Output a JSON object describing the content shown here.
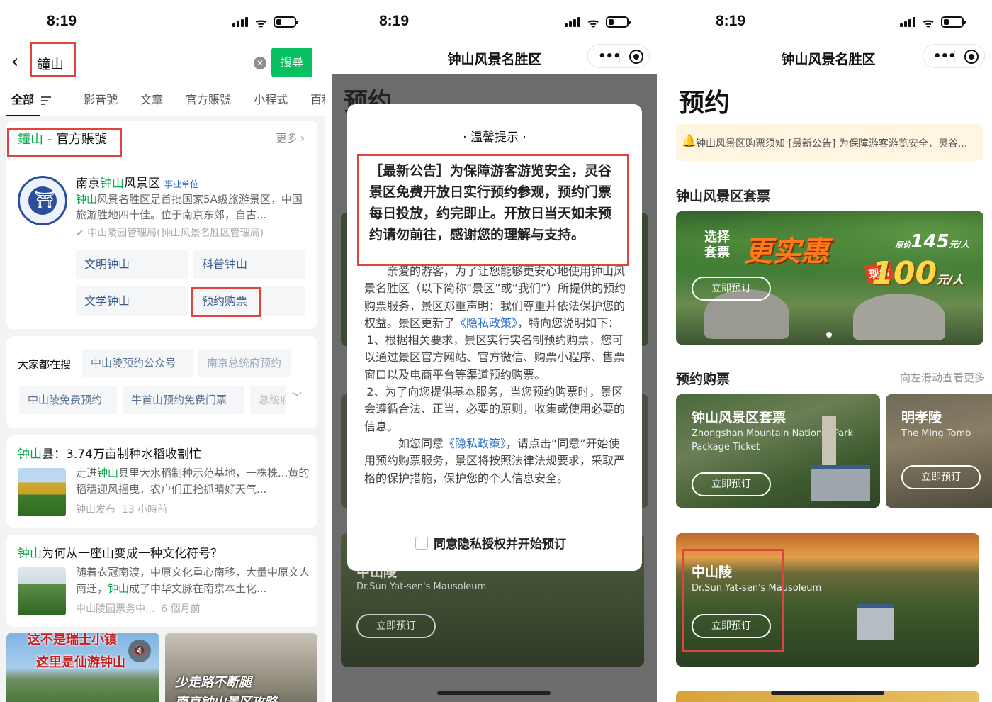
{
  "status": {
    "time": "8:19"
  },
  "search_panel": {
    "query": "鐘山",
    "search_button": "搜尋",
    "tabs": [
      "全部",
      "影音號",
      "文章",
      "官方賬號",
      "小程式",
      "百科"
    ],
    "official": {
      "heading_keyword": "鐘山",
      "heading_suffix": " - 官方賬號",
      "more": "更多",
      "name_prefix": "南京",
      "name_keyword": "钟山",
      "name_suffix": "风景区",
      "tag": "事业单位",
      "desc_keyword": "钟山",
      "desc_rest": "风景名胜区是首批国家5A级旅游景区，中国旅游胜地四十佳。位于南京东郊，自古...",
      "verified": "中山陵园管理局(钟山风景名胜区管理局)",
      "links": [
        "文明钟山",
        "科普钟山",
        "文学钟山",
        "预约购票"
      ]
    },
    "trending": {
      "label": "大家都在搜",
      "items": [
        "中山陵预约公众号",
        "南京总统府预约",
        "中山陵免费预约",
        "牛首山预约免费门票",
        "总统府"
      ]
    },
    "articles": [
      {
        "title_keyword": "钟山",
        "title_rest": "县：3.74万亩制种水稻收割忙",
        "desc_a": "走进",
        "desc_keyword": "钟山",
        "desc_b": "县里大水稻制种示范基地，一株株...黄的稻穗迎风摇曳，农户们正抢抓晴好天气...",
        "source": "钟山发布",
        "time": "13 小時前"
      },
      {
        "title_keyword": "钟山",
        "title_rest": "为何从一座山变成一种文化符号？",
        "desc_a": "随着衣冠南渡，中原文化重心南移，大量中原文人南迁，",
        "desc_keyword": "钟山",
        "desc_b": "成了中华文脉在南京本土化...",
        "source": "中山陵园票务中...",
        "time": "6 個月前"
      }
    ],
    "videos": [
      {
        "line1": "这不是瑞士小镇",
        "line2": "这里是仙游钟山"
      },
      {
        "line1": "少走路不断腿",
        "line2": "南京钟山景区攻略"
      }
    ]
  },
  "modal_panel": {
    "header_title": "钟山风景名胜区",
    "bg_title": "预约",
    "bg_card_name": "中山陵",
    "bg_card_en": "Dr.Sun Yat-sen's Mausoleum",
    "bg_card_button": "立即预订",
    "title": "· 温馨提示 ·",
    "notice": "［最新公告］为保障游客游览安全，灵谷景区免费开放日实行预约参观，预约门票每日投放，约完即止。开放日当天如未预约请勿前往，感谢您的理解与支持。",
    "para1_a": "亲爱的游客，为了让您能够更安心地使用钟山风景名胜区（以下简称“景区”或“我们”）所提供的预约购票服务，景区郑重声明：我们尊重并依法保护您的权益。景区更新了",
    "policy_link": "《隐私政策》",
    "para1_b": "，特向您说明如下：",
    "item1": "1、根据相关要求，景区实行实名制预约购票，您可以通过景区官方网站、官方微信、购票小程序、售票窗口以及电商平台等渠道预约购票。",
    "item2": "2、为了向您提供基本服务，当您预约购票时，景区会遵循合法、正当、必要的原则，收集或使用必要的信息。",
    "para2_a": "如您同意",
    "para2_b": "，请点击“同意”开始使用预约购票服务，景区将按照法律法规要求，采取严格的保护措施，保护您的个人信息安全。",
    "agree": "同意隐私授权并开始预订"
  },
  "booking_panel": {
    "header_title": "钟山风景名胜区",
    "title": "预约",
    "announcement": "钟山风景区购票须知 [最新公告] 为保障游客游览安全，灵谷...",
    "package_section": "钟山风景区套票",
    "banner": {
      "small1": "选择",
      "small2": "套票",
      "big": "更实惠",
      "orig_label": "原价",
      "orig_price": "145",
      "orig_unit": "元/人",
      "now_label": "现价",
      "now_price": "100",
      "now_unit": "元/人",
      "button": "立即预订"
    },
    "booking_section": "预约购票",
    "booking_more": "向左滑动查看更多",
    "tickets": [
      {
        "name": "钟山风景区套票",
        "en": "Zhongshan Mountain National Park Package Ticket",
        "button": "立即预订"
      },
      {
        "name": "明孝陵",
        "en": "The Ming Tomb",
        "button": "立即预订"
      },
      {
        "name": "中山陵",
        "en": "Dr.Sun Yat-sen's Mausoleum",
        "button": "立即预订"
      }
    ]
  }
}
